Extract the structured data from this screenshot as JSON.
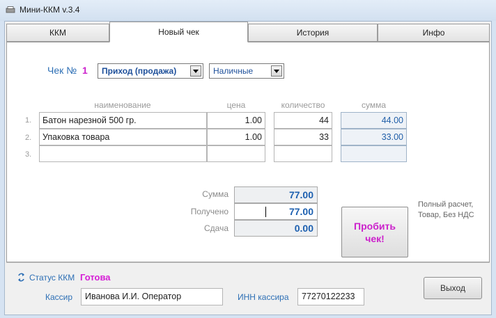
{
  "window": {
    "title": "Мини-ККМ v.3.4"
  },
  "tabs": [
    {
      "label": "ККМ",
      "active": false
    },
    {
      "label": "Новый чек",
      "active": true
    },
    {
      "label": "История",
      "active": false
    },
    {
      "label": "Инфо",
      "active": false
    }
  ],
  "receipt": {
    "label": "Чек №",
    "number": "1",
    "operation_type": "Приход (продажа)",
    "payment_type": "Наличные"
  },
  "table": {
    "headers": {
      "name": "наименование",
      "price": "цена",
      "qty": "количество",
      "sum": "сумма"
    },
    "rows": [
      {
        "n": "1.",
        "name": "Батон нарезной 500 гр.",
        "price": "1.00",
        "qty": "44",
        "sum": "44.00"
      },
      {
        "n": "2.",
        "name": "Упаковка товара",
        "price": "1.00",
        "qty": "33",
        "sum": "33.00"
      },
      {
        "n": "3.",
        "name": "",
        "price": "",
        "qty": "",
        "sum": ""
      }
    ]
  },
  "totals": {
    "sum_label": "Сумма",
    "sum_value": "77.00",
    "received_label": "Получено",
    "received_value": "77.00",
    "change_label": "Сдача",
    "change_value": "0.00"
  },
  "print_button": {
    "line1": "Пробить",
    "line2": "чек!"
  },
  "calc_note": {
    "line1": "Полный расчет,",
    "line2": "Товар, Без НДС"
  },
  "status": {
    "label": "Статус ККМ",
    "value": "Готова",
    "value_color": "#d61ed6"
  },
  "cashier": {
    "label": "Кассир",
    "value": "Иванова И.И. Оператор"
  },
  "inn": {
    "label": "ИНН кассира",
    "value": "77270122233"
  },
  "exit_button": {
    "label": "Выход"
  },
  "colors": {
    "accent_blue": "#1d60b0",
    "accent_magenta": "#cc22cc"
  }
}
